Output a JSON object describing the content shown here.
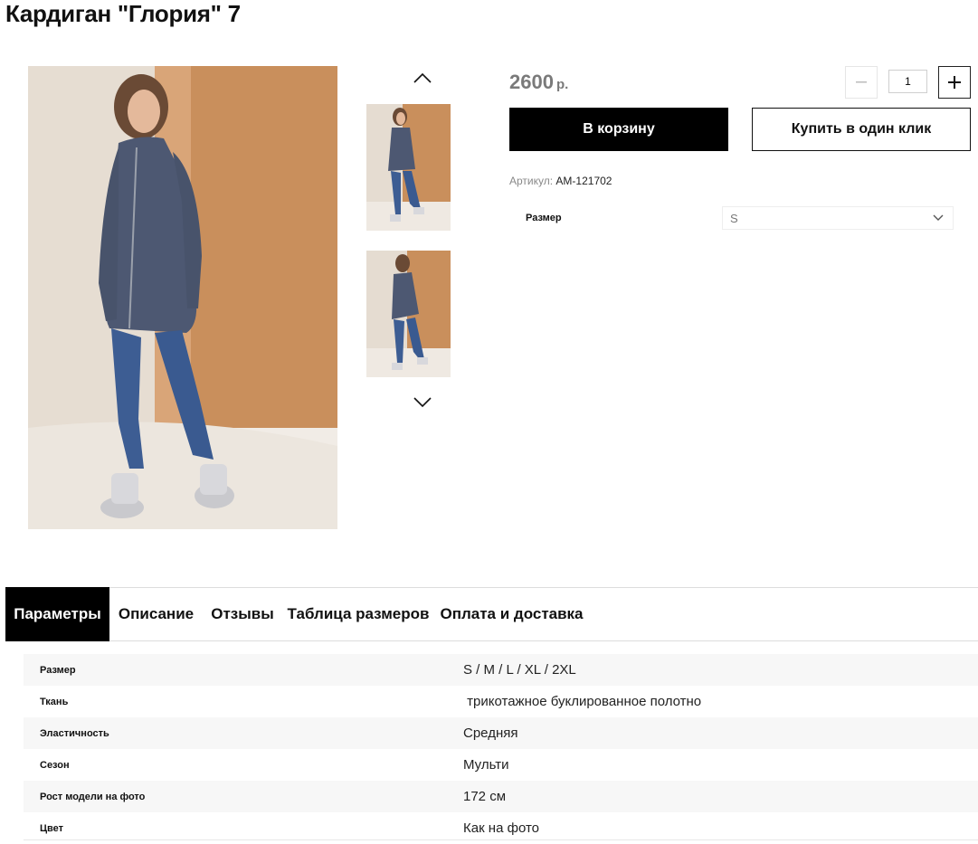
{
  "product": {
    "title": "Кардиган \"Глория\" 7",
    "price": "2600",
    "currency": "р.",
    "quantity": "1",
    "add_to_cart": "В корзину",
    "one_click": "Купить в один клик",
    "sku_label": "Артикул:",
    "sku_value": "AM-121702",
    "size_label": "Размер",
    "size_selected": "S"
  },
  "icons": {
    "gallery_up": "chevron-up-icon",
    "gallery_down": "chevron-down-icon",
    "minus": "minus-icon",
    "plus": "plus-icon",
    "select": "chevron-down-icon"
  },
  "tabs": [
    {
      "label": "Параметры",
      "active": true
    },
    {
      "label": "Описание",
      "active": false
    },
    {
      "label": "Отзывы",
      "active": false
    },
    {
      "label": "Таблица размеров",
      "active": false
    },
    {
      "label": "Оплата и доставка",
      "active": false
    }
  ],
  "params": [
    {
      "name": "Размер",
      "value": "S / M / L / XL / 2XL"
    },
    {
      "name": "Ткань",
      "value": " трикотажное буклированное полотно"
    },
    {
      "name": "Эластичность",
      "value": "Средняя"
    },
    {
      "name": "Сезон",
      "value": "Мульти"
    },
    {
      "name": "Рост модели на фото",
      "value": "172 см"
    },
    {
      "name": "Цвет",
      "value": "Как на фото"
    }
  ],
  "colors": {
    "accent": "#000000",
    "price": "#7a7a7a",
    "backdrop": "#c9905e"
  }
}
